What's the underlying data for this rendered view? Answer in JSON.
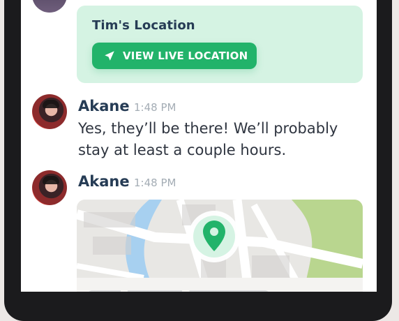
{
  "location_card": {
    "title": "Tim's Location",
    "button_label": "VIEW LIVE LOCATION",
    "icon": "navigation-arrow-icon"
  },
  "messages": [
    {
      "author": "Akane",
      "time": "1:48 PM",
      "text": "Yes, they’ll be there! We’ll probably stay at least a couple hours."
    },
    {
      "author": "Akane",
      "time": "1:48 PM"
    }
  ],
  "map": {
    "pin_icon": "location-pin-icon"
  },
  "colors": {
    "accent_green": "#22b36a",
    "card_green": "#d5f3e3",
    "name_text": "#263c55",
    "time_text": "#a4adb5",
    "map_water": "#a7d0f0",
    "map_park": "#b9d68f"
  }
}
